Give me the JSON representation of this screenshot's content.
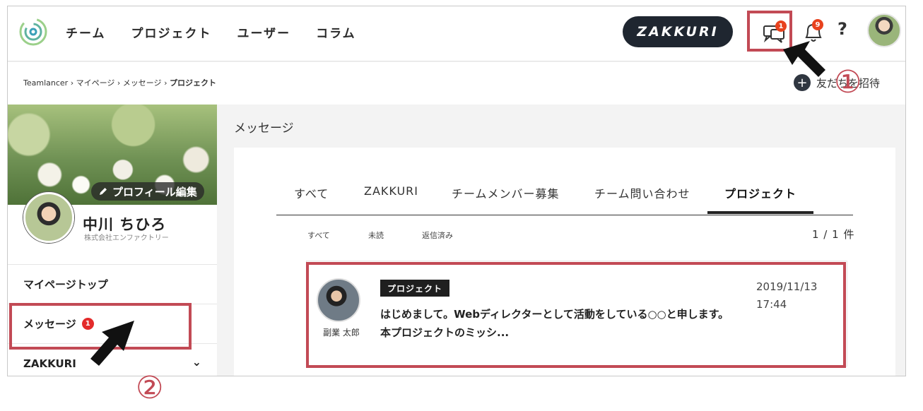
{
  "header": {
    "nav": [
      "チーム",
      "プロジェクト",
      "ユーザー",
      "コラム"
    ],
    "zakkuri_label": "ZAKKURI",
    "message_badge": "1",
    "notification_badge": "9",
    "help_label": "?"
  },
  "breadcrumb": {
    "items": [
      "Teamlancer",
      "マイページ",
      "メッセージ"
    ],
    "separator": "›",
    "current": "プロジェクト"
  },
  "invite": {
    "label": "友だちを招待"
  },
  "annotations": {
    "one": "①",
    "two": "②"
  },
  "sidebar": {
    "edit_profile_label": "プロフィール編集",
    "profile_name": "中川 ちひろ",
    "profile_company": "株式会社エンファクトリー",
    "items": [
      {
        "label": "マイページトップ"
      },
      {
        "label": "メッセージ",
        "badge": "1"
      },
      {
        "label": "ZAKKURI"
      }
    ]
  },
  "main": {
    "title": "メッセージ",
    "tabs": [
      "すべて",
      "ZAKKURI",
      "チームメンバー募集",
      "チーム問い合わせ",
      "プロジェクト"
    ],
    "active_tab": "プロジェクト",
    "filters": [
      "すべて",
      "未読",
      "返信済み"
    ],
    "count": "1 / 1 件",
    "message": {
      "tag": "プロジェクト",
      "line1": "はじめまして。Webディレクターとして活動をしている○○と申します。",
      "line2": "本プロジェクトのミッシ...",
      "date": "2019/11/13",
      "time": "17:44",
      "sender": "副業 太郎"
    }
  },
  "colors": {
    "annotation_red": "#c24a55",
    "badge_orange": "#e8421e",
    "dark": "#1f2630"
  },
  "icons": [
    "logo-icon",
    "message-icon",
    "bell-icon",
    "help-icon",
    "pencil-icon",
    "plus-icon",
    "chevron-down-icon",
    "arrow-pointer-icon"
  ]
}
